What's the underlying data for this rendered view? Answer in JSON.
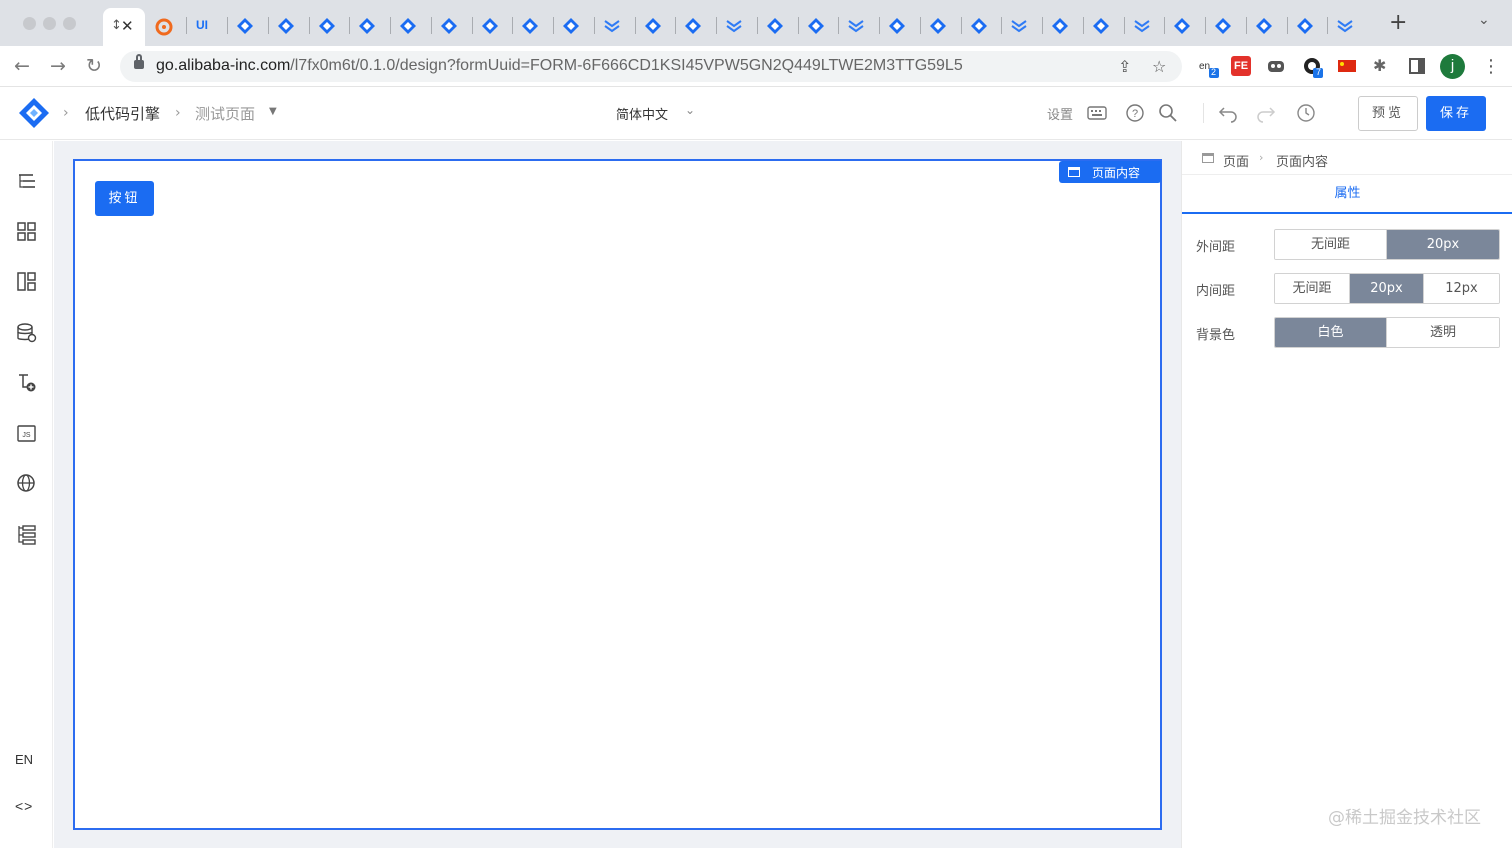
{
  "browser": {
    "url_host": "go.alibaba-inc.com",
    "url_path": "/l7fx0m6t/0.1.0/design?formUuid=FORM-6F666CD1KSI45VPW5GN2Q449LTWE2M3TTG59L5",
    "active_tab_glyph": "↕",
    "ui_tab_label": "UI",
    "new_tab_label": "+",
    "tab_menu_label": "⌄",
    "ext_badge_1": "2",
    "ext_badge_2": "7",
    "ext_fe_label": "FE",
    "profile_initial": "j"
  },
  "header": {
    "breadcrumb_app": "低代码引擎",
    "breadcrumb_page": "测试页面",
    "language": "简体中文",
    "settings_label": "设置",
    "preview_label": "预览",
    "save_label": "保存"
  },
  "left_toolbar": {
    "lang_label": "EN",
    "code_label": "<>"
  },
  "canvas": {
    "page_tag_label": "页面内容",
    "button_label": "按钮"
  },
  "right_panel": {
    "breadcrumb_root": "页面",
    "breadcrumb_current": "页面内容",
    "tab_label": "属性",
    "props": [
      {
        "label": "外间距",
        "options": [
          "无间距",
          "20px"
        ],
        "selected": 1
      },
      {
        "label": "内间距",
        "options": [
          "无间距",
          "20px",
          "12px"
        ],
        "selected": 1
      },
      {
        "label": "背景色",
        "options": [
          "白色",
          "透明"
        ],
        "selected": 0
      }
    ]
  },
  "watermark": "@稀土掘金技术社区",
  "colors": {
    "primary": "#1b6cf2",
    "selected_segment": "#7b879a",
    "canvas_bg": "#eff1f5"
  }
}
